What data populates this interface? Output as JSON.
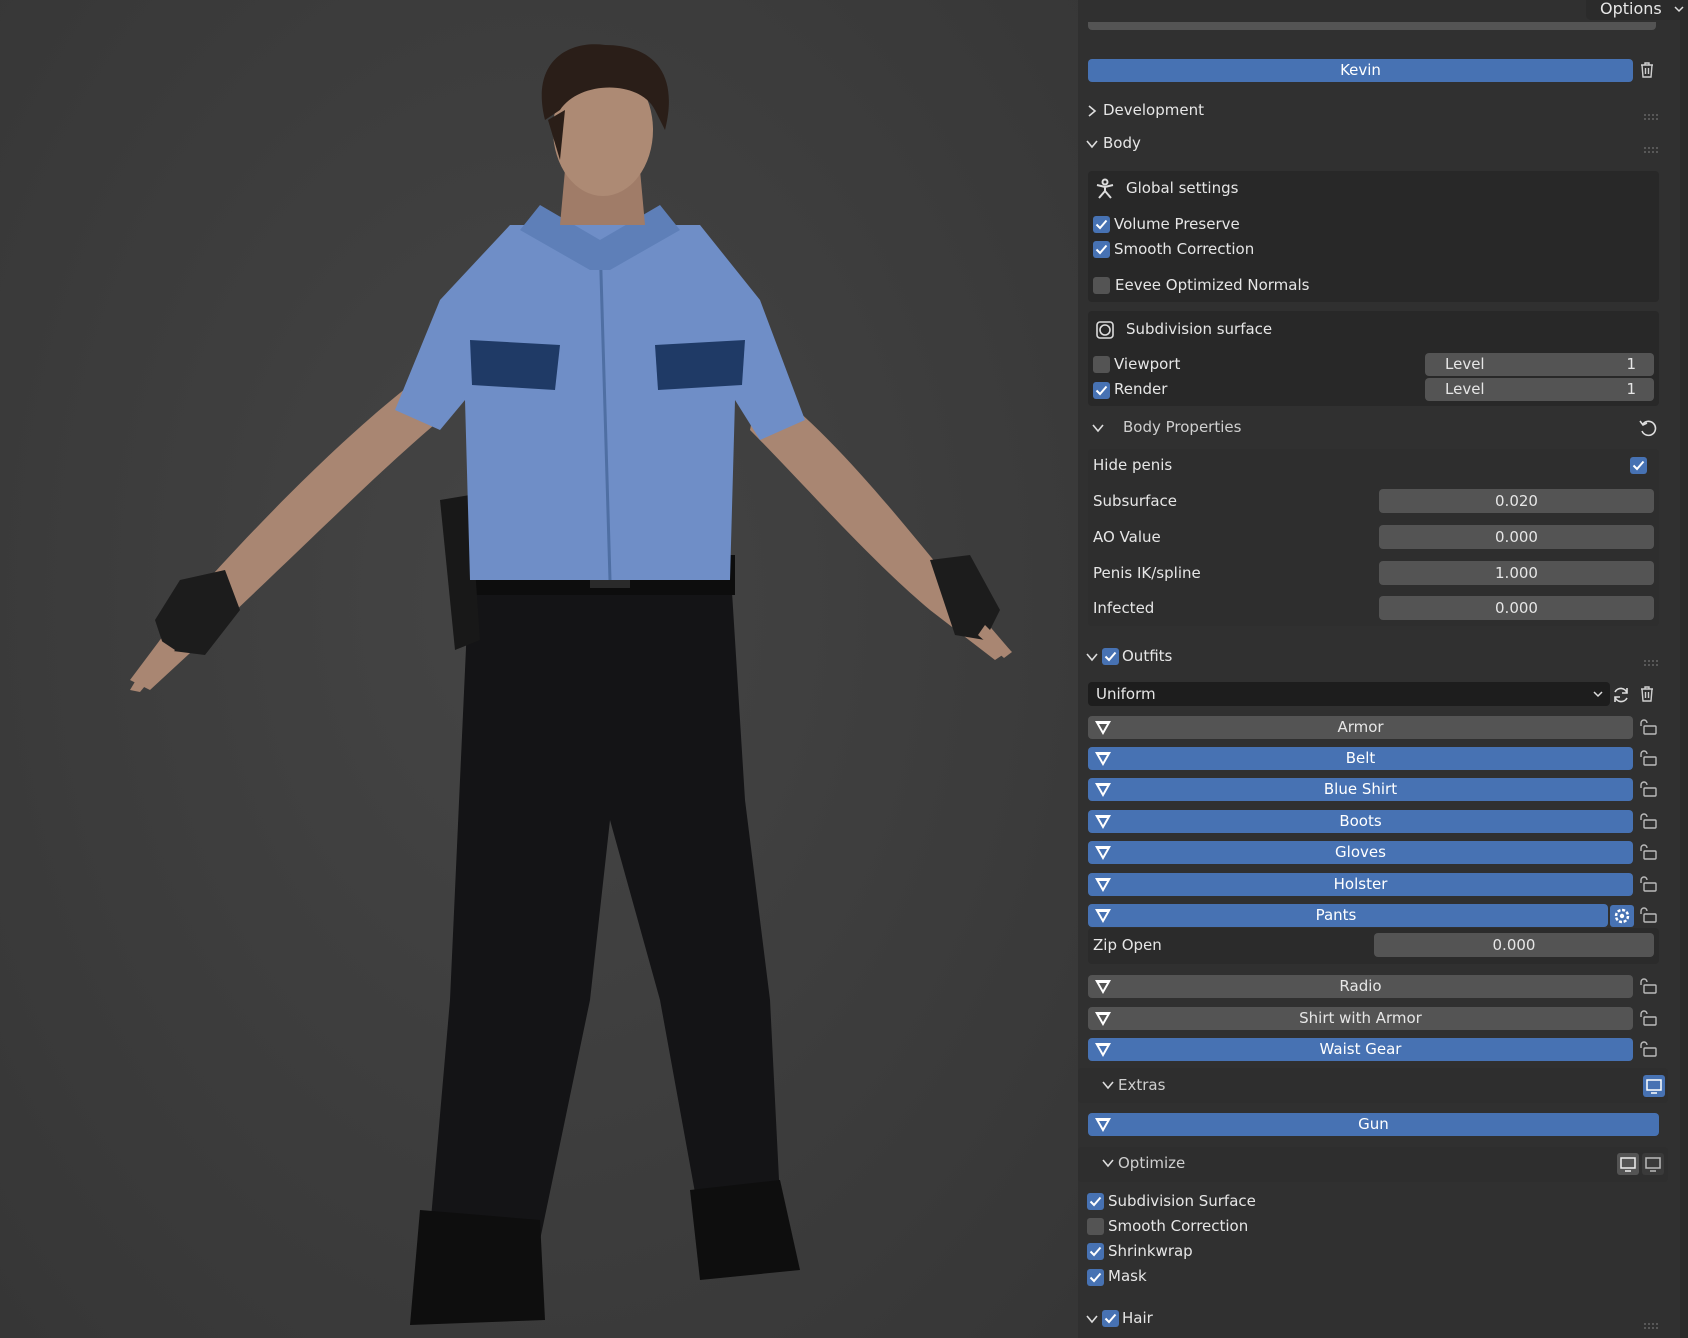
{
  "header": {
    "options_label": "Options"
  },
  "model": {
    "name": "Kevin"
  },
  "sections": {
    "development": "Development",
    "body": "Body"
  },
  "global_settings": {
    "title": "Global settings",
    "volume_preserve": "Volume Preserve",
    "smooth_correction": "Smooth Correction",
    "eevee_normals": "Eevee Optimized Normals"
  },
  "subdivision": {
    "title": "Subdivision surface",
    "viewport_label": "Viewport",
    "render_label": "Render",
    "level_label": "Level",
    "viewport_level": "1",
    "render_level": "1"
  },
  "body_properties": {
    "title": "Body Properties",
    "hide_penis": "Hide penis",
    "subsurface_label": "Subsurface",
    "subsurface_value": "0.020",
    "ao_label": "AO Value",
    "ao_value": "0.000",
    "ik_label": "Penis IK/spline",
    "ik_value": "1.000",
    "infected_label": "Infected",
    "infected_value": "0.000"
  },
  "outfits": {
    "title": "Outfits",
    "selected": "Uniform",
    "items": [
      {
        "label": "Armor",
        "active": false
      },
      {
        "label": "Belt",
        "active": true
      },
      {
        "label": "Blue Shirt",
        "active": true
      },
      {
        "label": "Boots",
        "active": true
      },
      {
        "label": "Gloves",
        "active": true
      },
      {
        "label": "Holster",
        "active": true
      },
      {
        "label": "Pants",
        "active": true
      },
      {
        "label": "Radio",
        "active": false
      },
      {
        "label": "Shirt with Armor",
        "active": false
      },
      {
        "label": "Waist Gear",
        "active": true
      }
    ],
    "zip_label": "Zip Open",
    "zip_value": "0.000"
  },
  "extras": {
    "title": "Extras",
    "gun": "Gun"
  },
  "optimize": {
    "title": "Optimize",
    "subdivision_surface": "Subdivision Surface",
    "smooth_correction": "Smooth Correction",
    "shrinkwrap": "Shrinkwrap",
    "mask": "Mask"
  },
  "hair": {
    "title": "Hair"
  },
  "colors": {
    "accent": "#4772b3",
    "panel": "#303030",
    "field": "#545454",
    "viewport": "#3d3d3d"
  }
}
